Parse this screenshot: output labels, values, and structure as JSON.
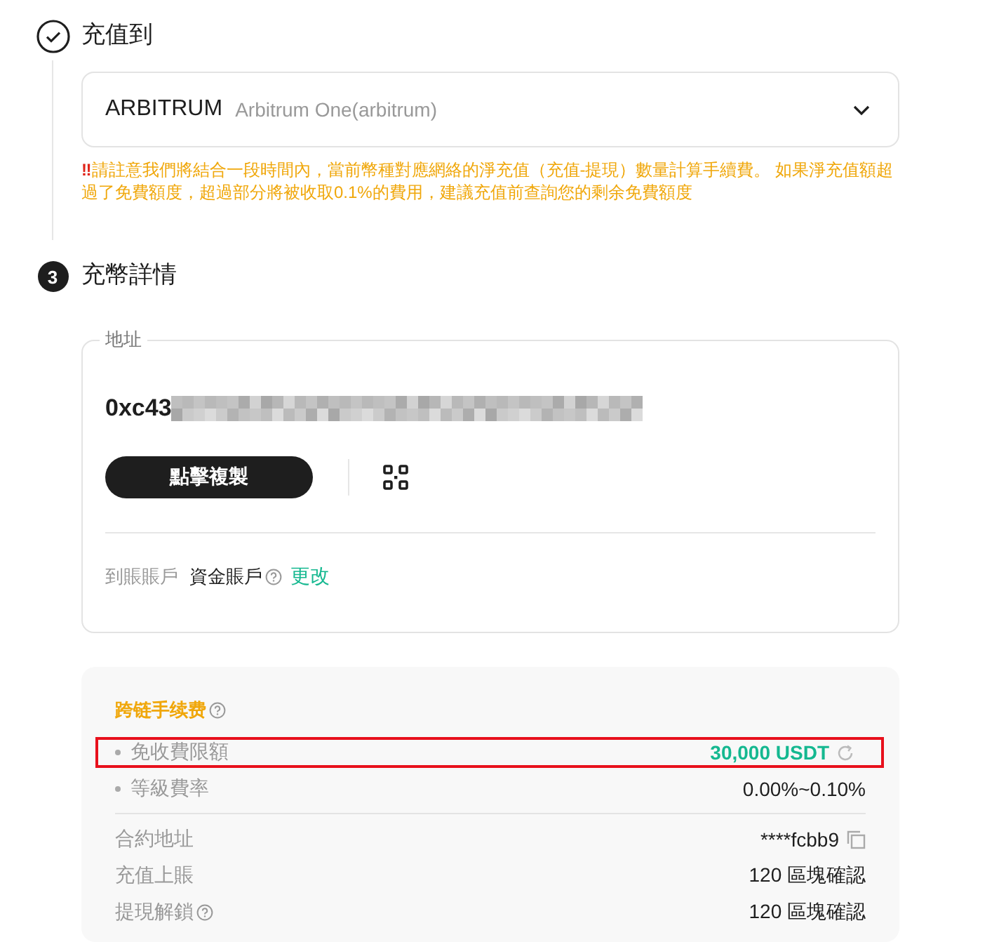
{
  "steps": [
    {
      "kind": "done",
      "title": "充值到"
    },
    {
      "kind": "numbered",
      "number": "3",
      "title": "充幣詳情"
    }
  ],
  "network": {
    "code": "ARBITRUM",
    "name": "Arbitrum One(arbitrum)",
    "expanded": false
  },
  "notice": {
    "icon": "‼",
    "text": "請註意我們將結合一段時間內，當前幣種對應網絡的淨充值（充值-提現）數量計算手續費。 如果淨充值額超過了免費額度，超過部分將被收取0.1%的費用，建議充值前查詢您的剩余免費額度"
  },
  "address": {
    "legend": "地址",
    "visible_part": "0xc43",
    "copy_button": "點擊複製",
    "account_label": "到賬賬戶",
    "account": "資金賬戶",
    "change_link": "更改"
  },
  "fees": {
    "title": "跨链手续费",
    "bullet_rows": [
      {
        "label": "免收費限額",
        "value": "30,000 USDT",
        "kind": "quota",
        "highlighted": true
      },
      {
        "label": "等級費率",
        "value": "0.00%~0.10%",
        "kind": "plain",
        "highlighted": false
      }
    ],
    "rows": [
      {
        "label": "合約地址",
        "value": "****fcbb9",
        "kind": "copy",
        "help": false
      },
      {
        "label": "充值上賬",
        "value": "120 區塊確認",
        "kind": "plain",
        "help": false
      },
      {
        "label": "提現解鎖",
        "value": "120 區塊確認",
        "kind": "plain",
        "help": true
      }
    ]
  }
}
